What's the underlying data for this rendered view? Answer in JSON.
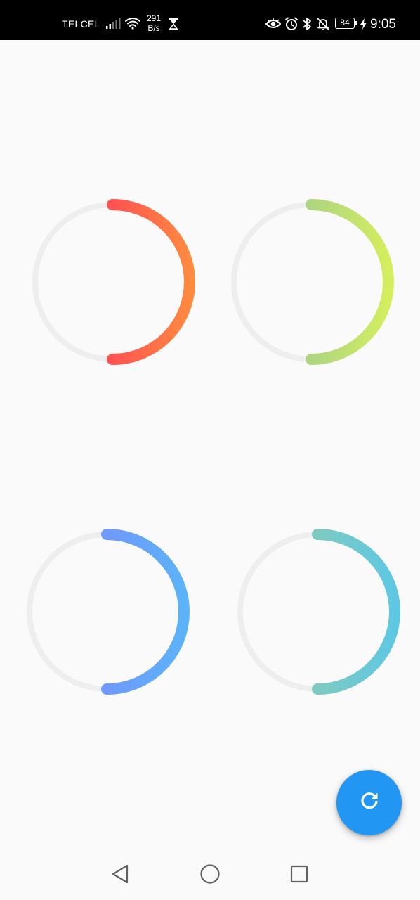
{
  "status_bar": {
    "carrier": "TELCEL",
    "net_speed_value": "291",
    "net_speed_unit": "B/s",
    "battery_level": "84",
    "time": "9:05",
    "icons": [
      "signal-icon",
      "wifi-icon",
      "hourglass-icon",
      "eye-icon",
      "alarm-icon",
      "bluetooth-icon",
      "notifications-off-icon",
      "battery-icon",
      "charging-icon"
    ]
  },
  "progress_rings": [
    {
      "name": "red-orange",
      "progress": 0.5,
      "start_angle_deg": 0,
      "gradient": [
        "#ff5252",
        "#ff8a40"
      ],
      "track_color": "#eeeeee"
    },
    {
      "name": "green-lime",
      "progress": 0.5,
      "start_angle_deg": 0,
      "gradient": [
        "#aed581",
        "#d4ee5e"
      ],
      "track_color": "#eeeeee"
    },
    {
      "name": "blue",
      "progress": 0.5,
      "start_angle_deg": 0,
      "gradient": [
        "#6f99fa",
        "#5cb3f8"
      ],
      "track_color": "#eeeeee"
    },
    {
      "name": "teal-cyan",
      "progress": 0.5,
      "start_angle_deg": 0,
      "gradient": [
        "#7ecac1",
        "#5ec8e3"
      ],
      "track_color": "#eeeeee"
    }
  ],
  "fab": {
    "icon": "refresh-icon",
    "color": "#2196f3"
  },
  "navigation_bar": {
    "icons": [
      "back-icon",
      "home-icon",
      "recents-icon"
    ]
  },
  "colors": {
    "background": "#fafafa",
    "status_bar": "#000000",
    "accent": "#2196f3"
  }
}
